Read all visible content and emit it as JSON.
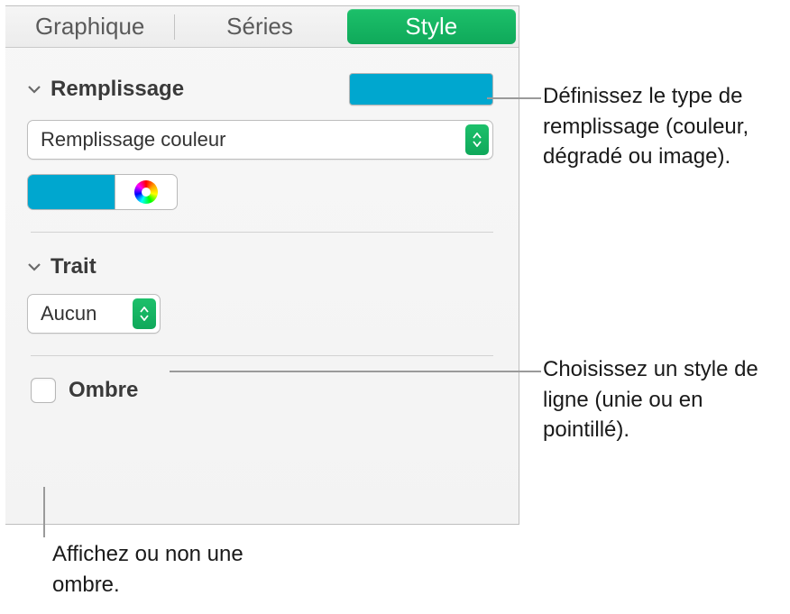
{
  "tabs": {
    "chart": "Graphique",
    "series": "Séries",
    "style": "Style"
  },
  "fill": {
    "title": "Remplissage",
    "type_label": "Remplissage couleur",
    "swatch_color": "#00a7cf"
  },
  "stroke": {
    "title": "Trait",
    "value": "Aucun"
  },
  "shadow": {
    "label": "Ombre"
  },
  "callouts": {
    "fill": "Définissez le type de remplissage (couleur, dégradé ou image).",
    "stroke": "Choisissez un style de ligne (unie ou en pointillé).",
    "shadow": "Affichez ou non une ombre."
  }
}
